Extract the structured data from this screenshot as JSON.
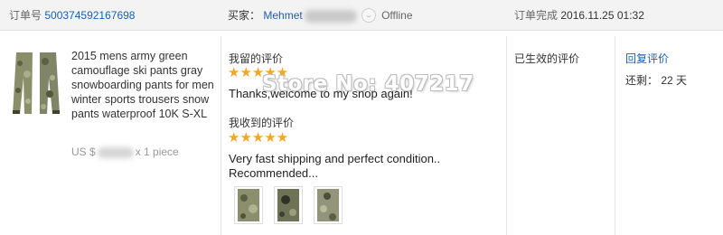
{
  "header": {
    "order_label": "订单号",
    "order_number": "500374592167698",
    "buyer_label": "买家：",
    "buyer_name": "Mehmet",
    "buyer_status": "Offline",
    "completed_label": "订单完成",
    "completed_time": "2016.11.25 01:32"
  },
  "product": {
    "title": "2015 mens army green camouflage ski pants gray snowboarding pants for men winter sports trousers snow pants waterproof 10K S-XL",
    "price_prefix": "US $",
    "quantity": "x 1 piece"
  },
  "feedback": {
    "my_label": "我留的评价",
    "my_stars": "★★★★★",
    "my_text": "Thanks,welcome to my shop again!",
    "received_label": "我收到的评价",
    "received_stars": "★★★★★",
    "received_text": "Very fast shipping and perfect condition.. Recommended...",
    "photo_count": 3,
    "star_color": "#f5a623"
  },
  "watermark": "Store No: 407217",
  "status": {
    "text": "已生效的评价"
  },
  "actions": {
    "reply_label": "回复评价",
    "remaining_label": "还剩：",
    "remaining_days": "22 天"
  },
  "colors": {
    "link": "#1a5fb4",
    "header_bg": "#f3f3f3"
  }
}
